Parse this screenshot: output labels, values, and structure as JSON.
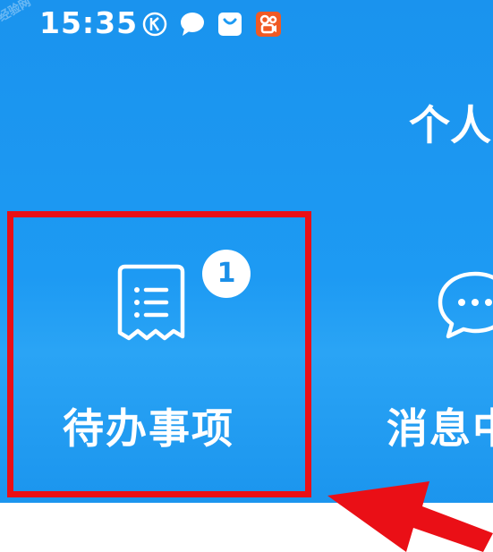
{
  "status_bar": {
    "time": "15:35",
    "icons": [
      "k-circle-icon",
      "chat-bubble-icon",
      "shopping-bag-icon",
      "kuaishou-app-icon"
    ]
  },
  "header": {
    "title": "个人"
  },
  "tiles": {
    "todo": {
      "label": "待办事项",
      "badge": "1",
      "icon": "receipt-list-icon"
    },
    "messages": {
      "label": "消息中",
      "icon": "message-bubble-icon"
    }
  },
  "annotation": {
    "highlight_color": "#ea0f16",
    "arrow_color": "#ea0f16"
  },
  "colors": {
    "header_blue": "#1d9af3",
    "badge_text": "#1a8fe8"
  }
}
